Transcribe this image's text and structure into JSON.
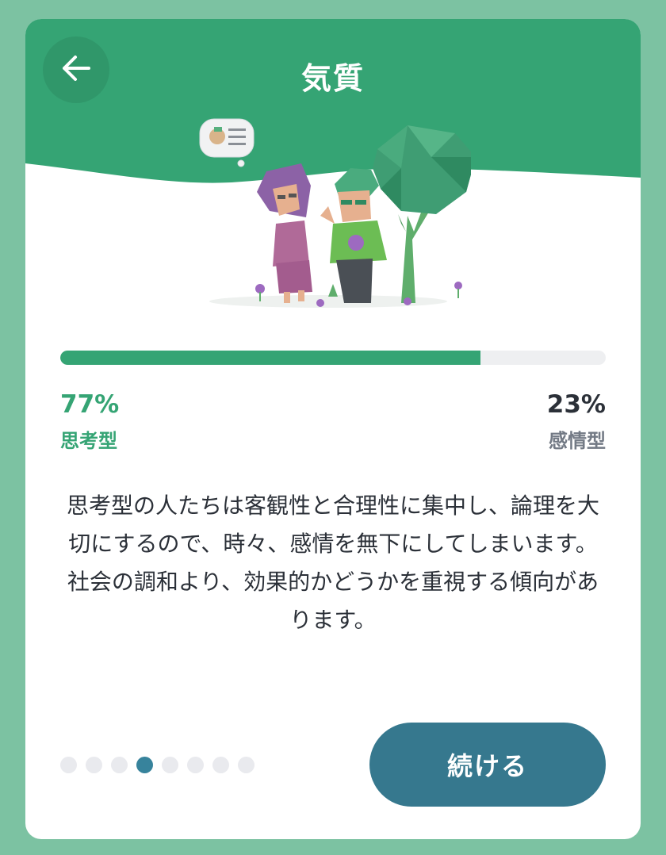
{
  "header": {
    "title": "気質",
    "back_icon": "arrow-left-icon",
    "background_color": "#35a474"
  },
  "illustration": {
    "icon": "couple-with-tree-illustration"
  },
  "trait": {
    "progress_percent": 77,
    "left_percent": "77%",
    "left_label": "思考型",
    "right_percent": "23%",
    "right_label": "感情型",
    "accent_color": "#35a474"
  },
  "description": "思考型の人たちは客観性と合理性に集中し、論理を大切にするので、時々、感情を無下にしてしまいます。社会の調和より、効果的かどうかを重視する傾向があります。",
  "pagination": {
    "total": 8,
    "active_index": 3,
    "active_color": "#37839c"
  },
  "footer": {
    "continue_label": "続ける",
    "button_color": "#36788e"
  }
}
